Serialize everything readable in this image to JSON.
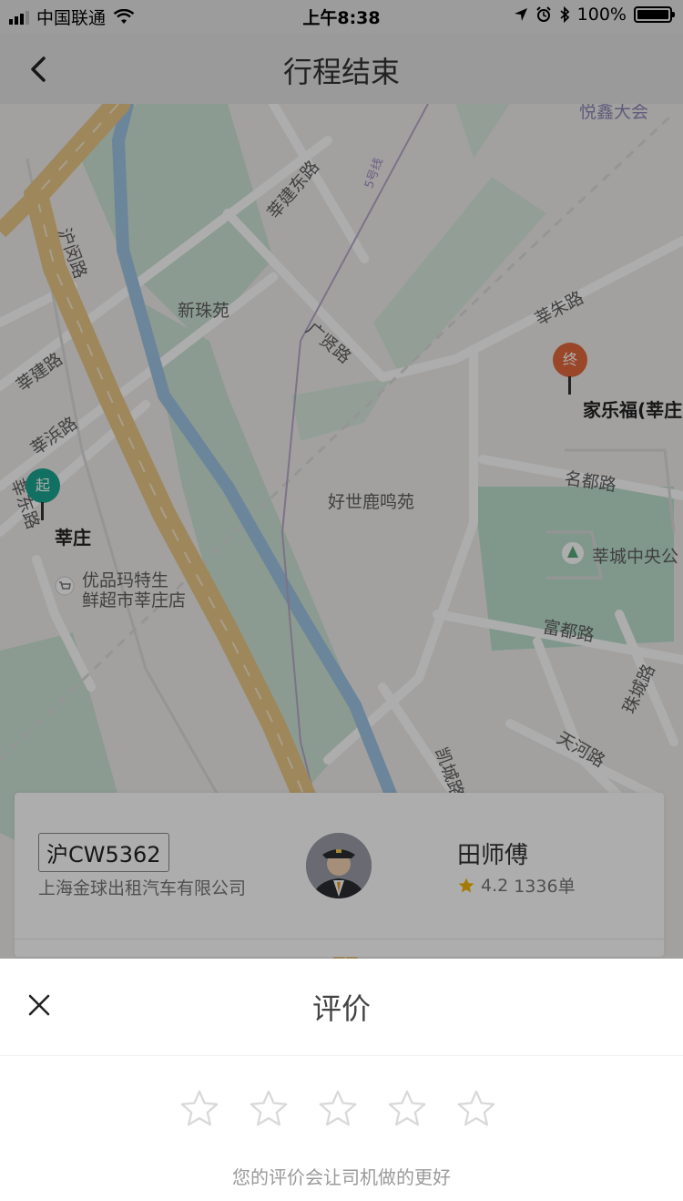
{
  "status_bar": {
    "carrier": "中国联通",
    "time": "上午8:38",
    "battery": "100%"
  },
  "nav": {
    "title": "行程结束"
  },
  "map": {
    "labels": {
      "road_xinjian_dong": "莘建东路",
      "road_humin": "沪闵路",
      "xinzhuyuan": "新珠苑",
      "road_xinjian": "莘建路",
      "road_xinzhu": "莘朱路",
      "road_guangtong": "广贤路",
      "road_xinzhuang": "莘浜路",
      "road_xinzhuang_dong": "莘东路",
      "haoshi": "好世鹿鸣苑",
      "road_mingdu": "名都路",
      "park": "莘城中央公",
      "road_fudu": "富都路",
      "road_zhucheng": "珠城路",
      "road_tianhe": "天河路",
      "road_kaicheng": "凯城路",
      "supermarket_line1": "优品玛特生",
      "supermarket_line2": "鲜超市莘庄店",
      "top_right": "悦鑫大会",
      "metro": "5号线"
    },
    "start": {
      "pin_text": "起",
      "name": "莘庄",
      "color": "#1aa58f"
    },
    "end": {
      "pin_text": "终",
      "name": "家乐福(莘庄",
      "color": "#e2693b"
    }
  },
  "driver": {
    "plate": "沪CW5362",
    "company": "上海金球出租汽车有限公司",
    "name": "田师傅",
    "rating": "4.2",
    "orders": "1336单",
    "star_color": "#f2b705"
  },
  "rating_sheet": {
    "title": "评价",
    "hint": "您的评价会让司机做的更好",
    "stars": 5
  }
}
